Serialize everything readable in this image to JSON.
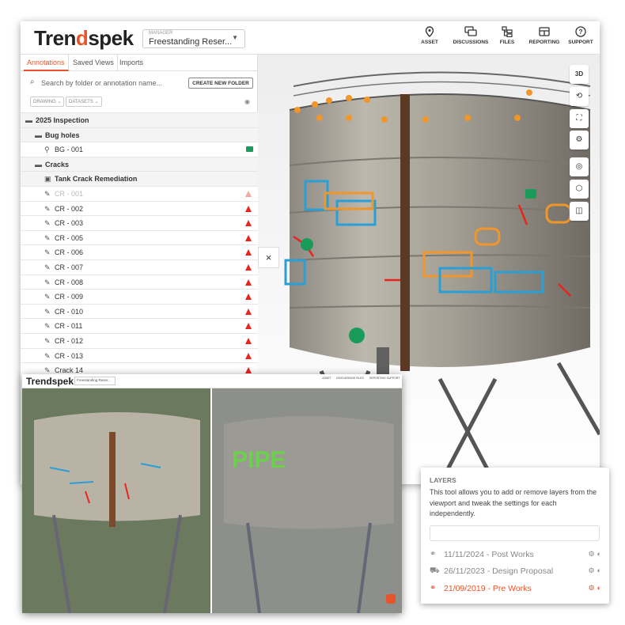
{
  "app": {
    "logo_main": "Tren",
    "logo_accent": "d",
    "logo_rest": "spek"
  },
  "manager": {
    "caption": "MANAGER",
    "value": "Freestanding Reser..."
  },
  "nav": [
    {
      "label": "ASSET",
      "icon": "location-icon"
    },
    {
      "label": "DISCUSSIONS",
      "icon": "discussions-icon"
    },
    {
      "label": "FILES",
      "icon": "files-icon"
    },
    {
      "label": "REPORTING",
      "icon": "reporting-icon"
    },
    {
      "label": "SUPPORT",
      "icon": "support-icon"
    }
  ],
  "sidebar": {
    "tabs": [
      "Annotations",
      "Saved Views",
      "Imports"
    ],
    "search_placeholder": "Search by folder or annotation name...",
    "new_folder": "CREATE NEW FOLDER",
    "filters": [
      "DRAWING",
      "DATASETS"
    ],
    "rows": [
      {
        "label": "2025 Inspection",
        "type": "folder",
        "indent": 0,
        "bold": true
      },
      {
        "label": "Bug holes",
        "type": "folder",
        "indent": 1,
        "bold": true
      },
      {
        "label": "BG - 001",
        "type": "pin",
        "indent": 2,
        "status": "camera"
      },
      {
        "label": "Cracks",
        "type": "folder",
        "indent": 1,
        "bold": true
      },
      {
        "label": "Tank Crack Remediation",
        "type": "group",
        "indent": 2,
        "bold": true
      },
      {
        "label": "CR - 001",
        "type": "line",
        "indent": 2,
        "status": "warn-dim",
        "dim": true
      },
      {
        "label": "CR - 002",
        "type": "line",
        "indent": 2,
        "status": "warn"
      },
      {
        "label": "CR - 003",
        "type": "line",
        "indent": 2,
        "status": "warn"
      },
      {
        "label": "CR - 005",
        "type": "line",
        "indent": 2,
        "status": "warn"
      },
      {
        "label": "CR - 006",
        "type": "line",
        "indent": 2,
        "status": "warn"
      },
      {
        "label": "CR - 007",
        "type": "line",
        "indent": 2,
        "status": "warn"
      },
      {
        "label": "CR - 008",
        "type": "line",
        "indent": 2,
        "status": "warn"
      },
      {
        "label": "CR - 009",
        "type": "line",
        "indent": 2,
        "status": "warn"
      },
      {
        "label": "CR - 010",
        "type": "line",
        "indent": 2,
        "status": "warn"
      },
      {
        "label": "CR - 011",
        "type": "line",
        "indent": 2,
        "status": "warn"
      },
      {
        "label": "CR - 012",
        "type": "line",
        "indent": 2,
        "status": "warn"
      },
      {
        "label": "CR - 013",
        "type": "line",
        "indent": 2,
        "status": "warn"
      },
      {
        "label": "Crack 14",
        "type": "line",
        "indent": 2,
        "status": "warn"
      }
    ]
  },
  "viewport": {
    "close": "×",
    "tools": [
      "3D",
      "⟲",
      "⛶",
      "⚙",
      "◎",
      "⬡",
      "◫"
    ]
  },
  "inset": {
    "logo": "Trendspek",
    "manager": "Freestanding Reser...",
    "nav": [
      "ASSET",
      "DISCUSSIONS",
      "FILES",
      "REPORTING",
      "SUPPORT"
    ]
  },
  "layers": {
    "heading": "LAYERS",
    "description": "This tool allows you to add or remove layers from the viewport and tweak the settings for each independently.",
    "items": [
      {
        "label": "11/11/2024 - Post Works",
        "icon": "layer-icon",
        "active": false
      },
      {
        "label": "26/11/2023 - Design Proposal",
        "icon": "design-icon",
        "active": false
      },
      {
        "label": "21/09/2019 - Pre Works",
        "icon": "layer-icon",
        "active": true
      }
    ]
  },
  "colors": {
    "accent": "#e8542a",
    "warn": "#e8251c",
    "ok": "#1a9b5a",
    "annot_blue": "#2a9fd6",
    "annot_orange": "#f0962a"
  }
}
